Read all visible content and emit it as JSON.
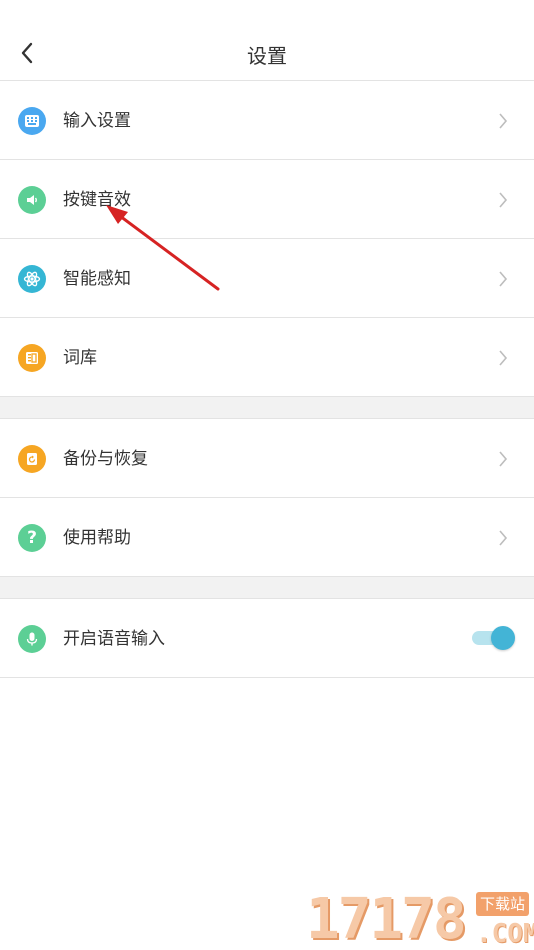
{
  "header": {
    "title": "设置"
  },
  "colors": {
    "blue_icon": "#4aa8f0",
    "green_icon": "#5ccf95",
    "cyan_icon": "#35b6d4",
    "orange_icon": "#f6a623",
    "toggle_on": "#43b4d6",
    "annotation_arrow": "#d62323"
  },
  "group1": [
    {
      "label": "输入设置",
      "icon": "keyboard-icon"
    },
    {
      "label": "按键音效",
      "icon": "speaker-icon"
    },
    {
      "label": "智能感知",
      "icon": "atom-icon"
    },
    {
      "label": "词库",
      "icon": "dictionary-icon"
    }
  ],
  "group2": [
    {
      "label": "备份与恢复",
      "icon": "backup-icon"
    },
    {
      "label": "使用帮助",
      "icon": "help-icon"
    }
  ],
  "group3": [
    {
      "label": "开启语音输入",
      "icon": "microphone-icon",
      "toggle_on": true
    }
  ],
  "watermark": {
    "digits": "17178",
    "badge": "下载站",
    "suffix": ".COM"
  }
}
